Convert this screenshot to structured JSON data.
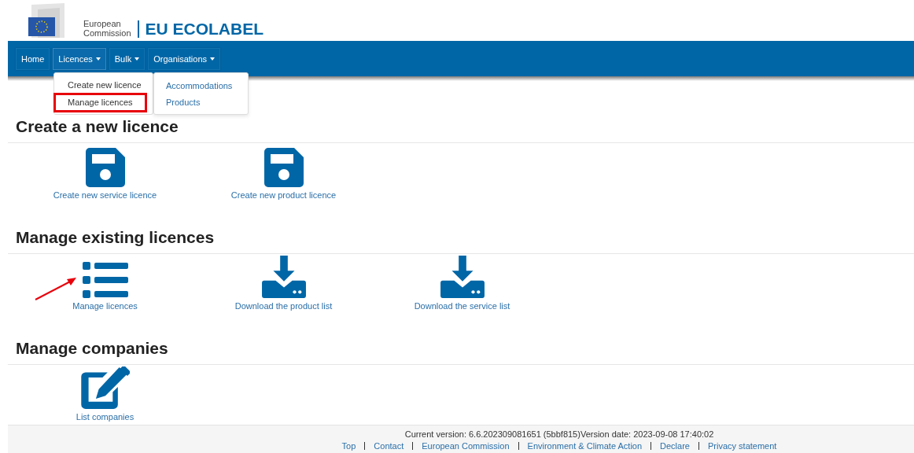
{
  "header": {
    "org_line1": "European",
    "org_line2": "Commission",
    "site_title": "EU ECOLABEL"
  },
  "nav": [
    {
      "label": "Home",
      "dropdown": false,
      "expanded": false
    },
    {
      "label": "Licences",
      "dropdown": true,
      "expanded": true
    },
    {
      "label": "Bulk",
      "dropdown": true,
      "expanded": false
    },
    {
      "label": "Organisations",
      "dropdown": true,
      "expanded": false
    }
  ],
  "licences_menu": [
    {
      "label": "Create new licence",
      "has_submenu": true,
      "highlighted": false
    },
    {
      "label": "Manage licences",
      "has_submenu": false,
      "highlighted": true
    }
  ],
  "submenu": [
    {
      "label": "Accommodations"
    },
    {
      "label": "Products"
    }
  ],
  "sections": [
    {
      "title": "Create a new licence",
      "tiles": [
        {
          "kind": "save",
          "label": "Create new service licence",
          "arrow": false
        },
        {
          "kind": "save",
          "label": "Create new product licence",
          "arrow": false
        }
      ]
    },
    {
      "title": "Manage existing licences",
      "tiles": [
        {
          "kind": "list",
          "label": "Manage licences",
          "arrow": true
        },
        {
          "kind": "download",
          "label": "Download the product list",
          "arrow": false
        },
        {
          "kind": "download",
          "label": "Download the service list",
          "arrow": false
        }
      ]
    },
    {
      "title": "Manage companies",
      "tiles": [
        {
          "kind": "edit",
          "label": "List companies",
          "arrow": false
        }
      ]
    }
  ],
  "footer": {
    "version": "Current version: 6.6.202309081651 (5bbf815)Version date: 2023-09-08 17:40:02",
    "links": [
      "Top",
      "Contact",
      "European Commission",
      "Environment & Climate Action",
      "Declare",
      "Privacy statement"
    ]
  }
}
